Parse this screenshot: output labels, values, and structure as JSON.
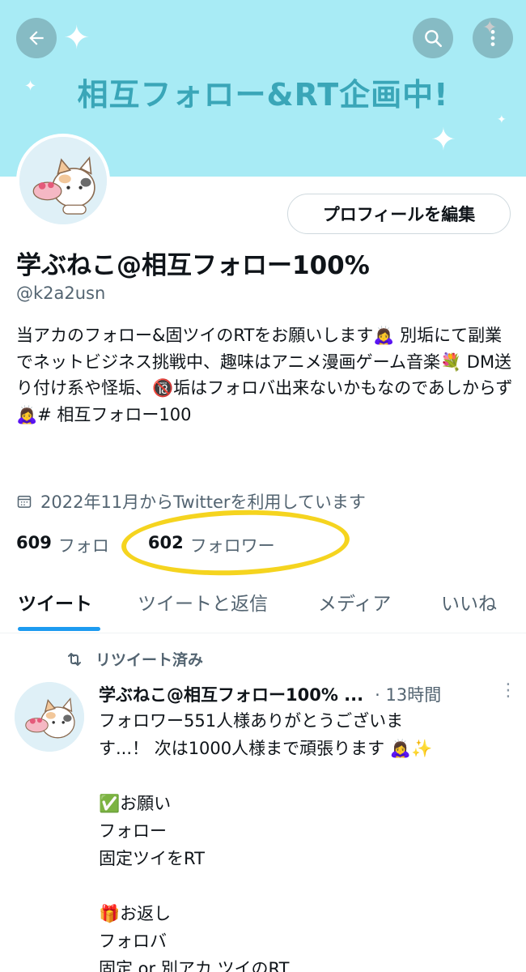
{
  "banner": {
    "title": "相互フォロー&RT企画中!",
    "bg_color": "#a8ebf5",
    "title_color": "#3aa6b8"
  },
  "nav": {
    "back_icon": "back-arrow-icon",
    "search_icon": "search-icon",
    "more_icon": "more-vertical-icon"
  },
  "profile": {
    "edit_button": "プロフィールを編集",
    "display_name": "学ぶねこ@相互フォロー100%",
    "handle": "@k2a2usn",
    "bio": "当アカのフォロー&固ツイのRTをお願いします🙇‍♀️ 別垢にて副業でネットビジネス挑戦中、趣味はアニメ漫画ゲーム音楽💐 DM送り付け系や怪垢、🔞垢はフォロバ出来ないかもなのであしからず🙇‍♀️# 相互フォロー100",
    "joined": "2022年11月からTwitterを利用しています",
    "following_count": "609",
    "following_label": "フォロ",
    "followers_count": "602",
    "followers_label": "フォロワー",
    "highlight_color": "#f5d41f"
  },
  "tabs": [
    {
      "label": "ツイート",
      "active": true
    },
    {
      "label": "ツイートと返信",
      "active": false
    },
    {
      "label": "メディア",
      "active": false
    },
    {
      "label": "いいね",
      "active": false
    }
  ],
  "tweet": {
    "retweet_label": "リツイート済み",
    "author": "学ぶねこ@相互フォロー100% ...",
    "time": "· 13時間",
    "body": "フォロワー551人様ありがとうございま\nす...！ 次は1000人様まで頑張ります 🙇‍♀️✨\n\n✅お願い\nフォロー\n固定ツイをRT\n\n🎁お返し\nフォロバ\n固定 or 別アカ ツイのRT"
  },
  "accent_color": "#1d9bf0"
}
